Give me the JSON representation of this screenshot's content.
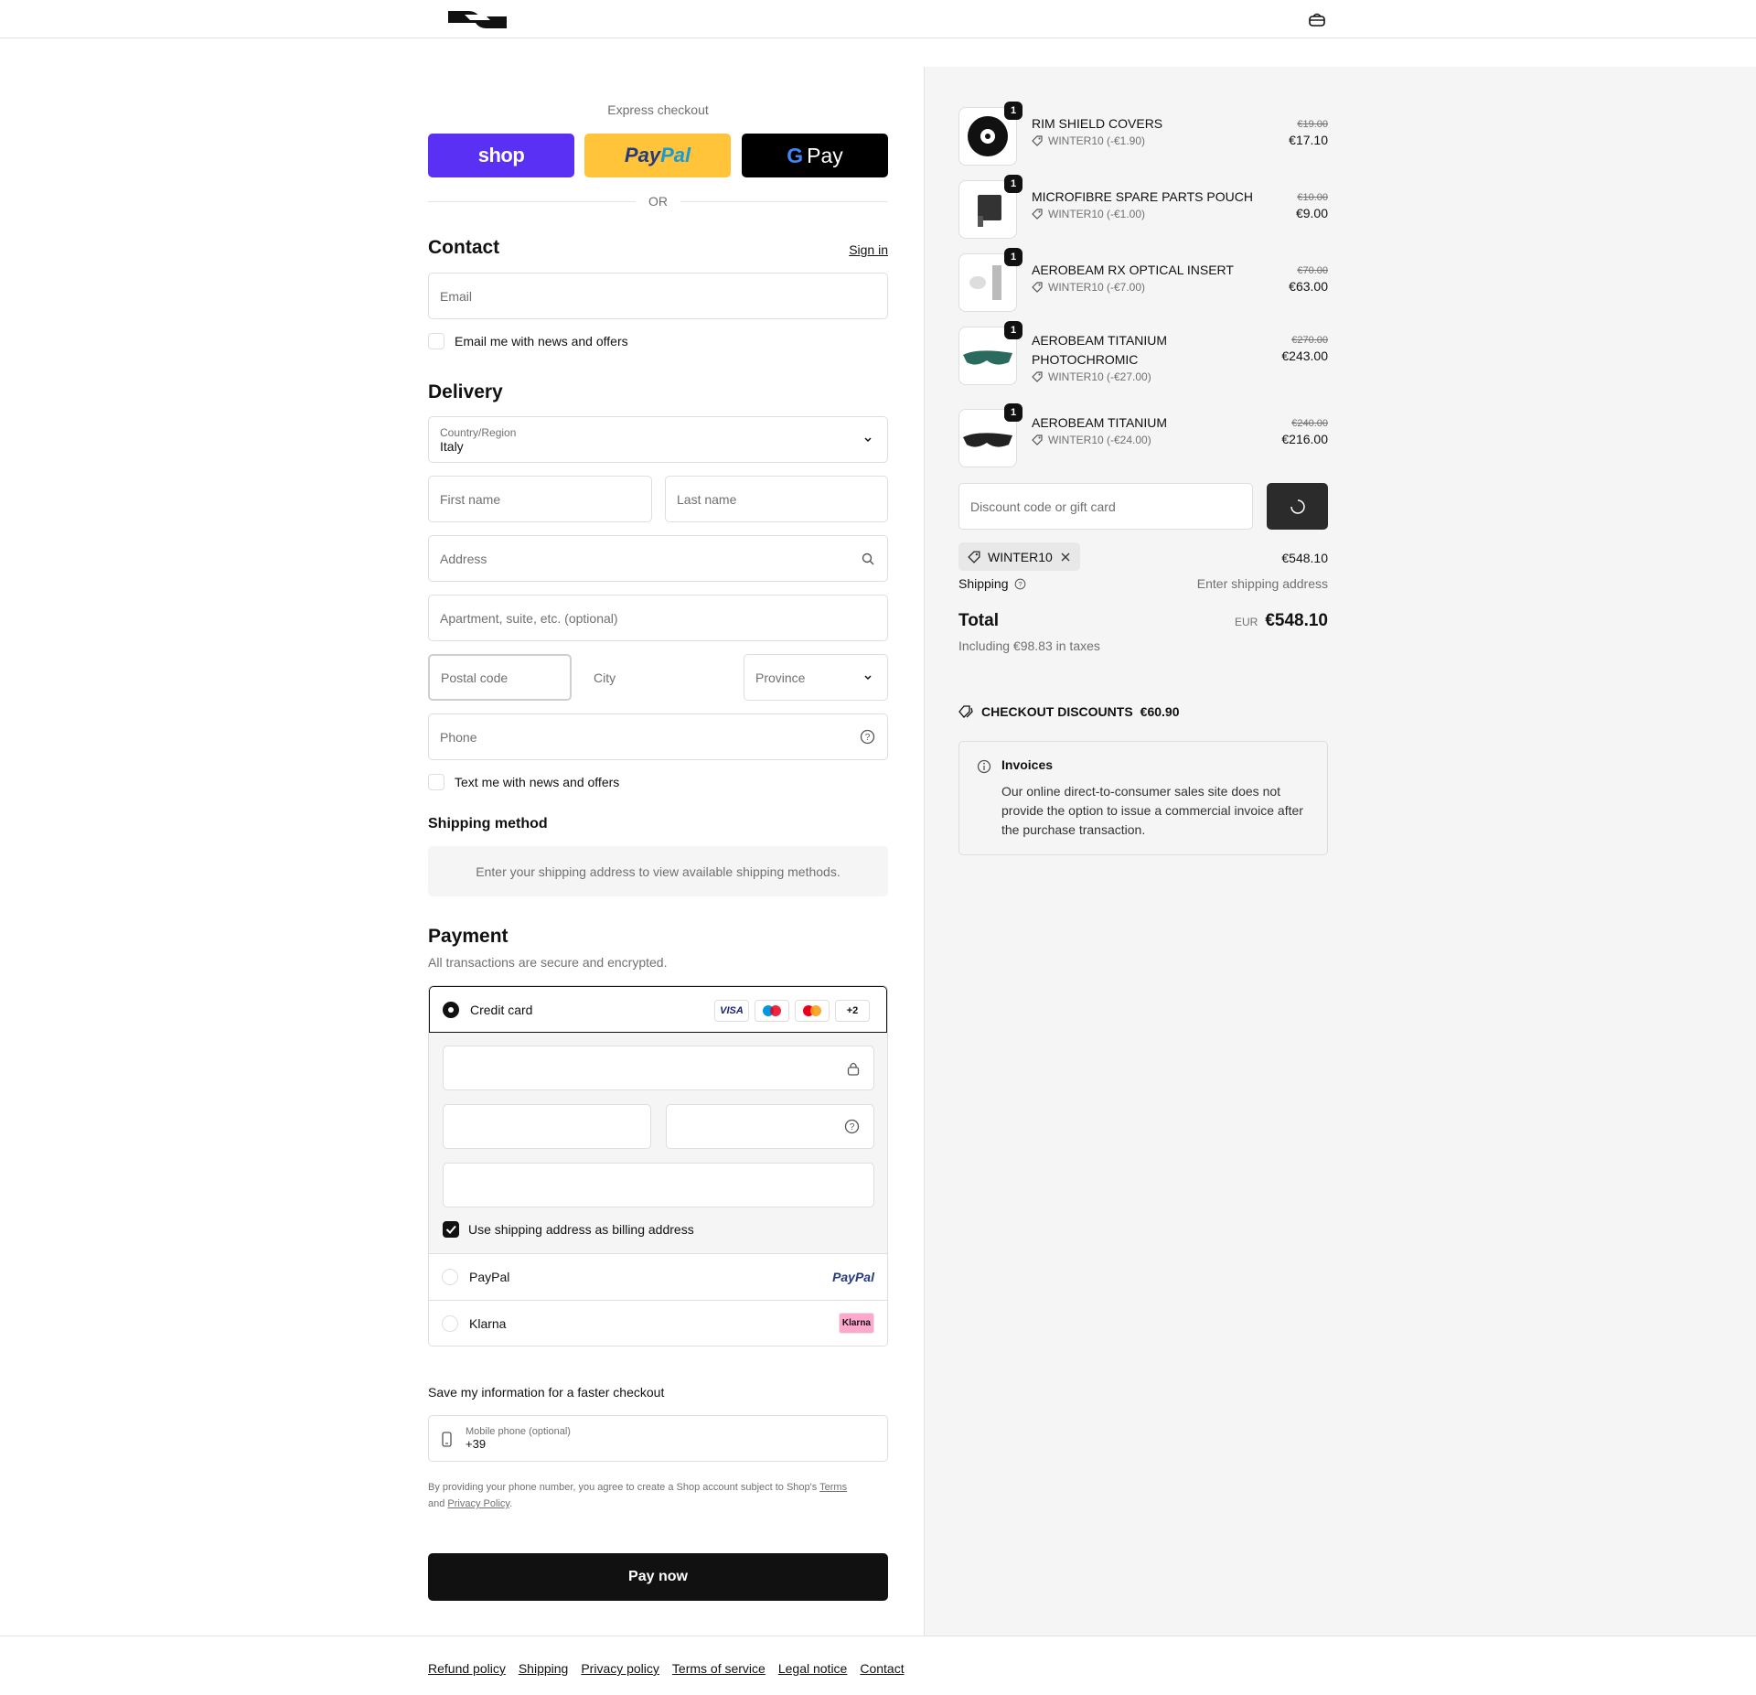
{
  "header": {
    "logo_alt": "brand-logo",
    "bag_icon": "bag-icon"
  },
  "express": {
    "label": "Express checkout",
    "shop_label": "shop",
    "paypal_label": "PayPal",
    "gpay_label": "Pay",
    "or_label": "OR"
  },
  "contact": {
    "title": "Contact",
    "sign_in": "Sign in",
    "email_placeholder": "Email",
    "news_label": "Email me with news and offers"
  },
  "delivery": {
    "title": "Delivery",
    "country_label": "Country/Region",
    "country_value": "Italy",
    "first_name": "First name",
    "last_name": "Last name",
    "address": "Address",
    "apartment": "Apartment, suite, etc. (optional)",
    "postal": "Postal code",
    "city": "City",
    "province": "Province",
    "phone": "Phone",
    "text_label": "Text me with news and offers"
  },
  "shipping_method": {
    "title": "Shipping method",
    "message": "Enter your shipping address to view available shipping methods."
  },
  "payment": {
    "title": "Payment",
    "subtitle": "All transactions are secure and encrypted.",
    "credit_card": "Credit card",
    "card_brands": [
      "VISA",
      "+2"
    ],
    "billing_label": "Use shipping address as billing address",
    "paypal": "PayPal",
    "paypal_logo": "PayPal",
    "klarna": "Klarna",
    "klarna_logo": "Klarna"
  },
  "save_info": {
    "title": "Save my information for a faster checkout",
    "phone_label": "Mobile phone (optional)",
    "phone_value": "+39",
    "legal_prefix": "By providing your phone number, you agree to create a Shop account subject to Shop's ",
    "terms": "Terms",
    "and": " and ",
    "privacy": "Privacy Policy",
    "dot": "."
  },
  "pay_now": "Pay now",
  "footer": {
    "links": [
      "Refund policy",
      "Shipping",
      "Privacy policy",
      "Terms of service",
      "Legal notice",
      "Contact"
    ]
  },
  "order": {
    "items": [
      {
        "name": "RIM SHIELD COVERS",
        "qty": "1",
        "discount": "WINTER10 (-€1.90)",
        "old_price": "€19.00",
        "price": "€17.10"
      },
      {
        "name": "MICROFIBRE SPARE PARTS POUCH",
        "qty": "1",
        "discount": "WINTER10 (-€1.00)",
        "old_price": "€10.00",
        "price": "€9.00"
      },
      {
        "name": "AEROBEAM RX OPTICAL INSERT",
        "qty": "1",
        "discount": "WINTER10 (-€7.00)",
        "old_price": "€70.00",
        "price": "€63.00"
      },
      {
        "name": "AEROBEAM TITANIUM PHOTOCHROMIC",
        "qty": "1",
        "discount": "WINTER10 (-€27.00)",
        "old_price": "€270.00",
        "price": "€243.00"
      },
      {
        "name": "AEROBEAM TITANIUM",
        "qty": "1",
        "discount": "WINTER10 (-€24.00)",
        "old_price": "€240.00",
        "price": "€216.00"
      }
    ],
    "discount_placeholder": "Discount code or gift card",
    "applied_code": "WINTER10",
    "subtotal": "€548.10",
    "shipping_label": "Shipping",
    "shipping_value": "Enter shipping address",
    "total_label": "Total",
    "currency": "EUR",
    "total": "€548.10",
    "taxes": "Including €98.83 in taxes",
    "checkout_discounts_label": "CHECKOUT DISCOUNTS",
    "checkout_discounts_value": "€60.90",
    "invoice_title": "Invoices",
    "invoice_text": "Our online direct-to-consumer sales site does not provide the option to issue a commercial invoice after the purchase transaction."
  },
  "colors": {
    "shop": "#5a31f4",
    "paypal": "#ffc439",
    "gpay": "#000000",
    "accent": "#111111"
  }
}
